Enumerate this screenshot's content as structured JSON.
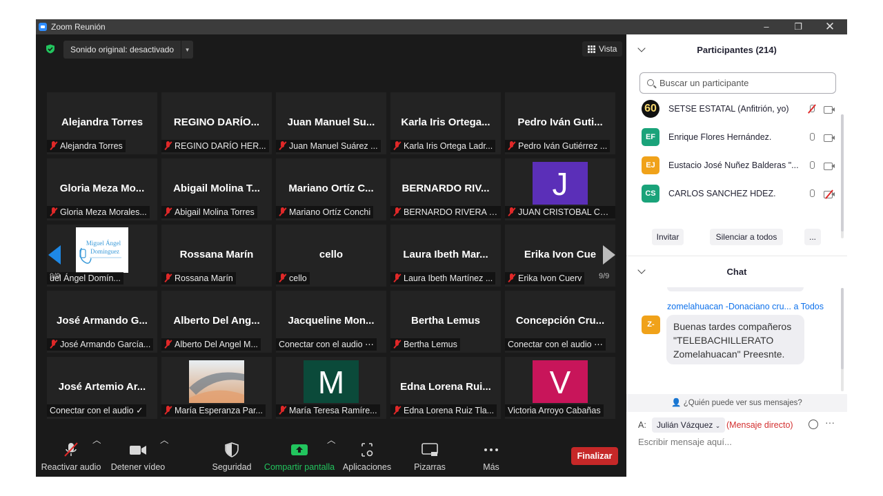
{
  "window": {
    "title": "Zoom Reunión",
    "minimize": "–",
    "maximize": "❐",
    "close": "✕"
  },
  "video": {
    "audio_button": "Sonido original: desactivado",
    "view_button": "Vista",
    "page_left": "9/9",
    "page_right": "9/9",
    "tiles": [
      {
        "display": "Alejandra Torres",
        "label": "Alejandra Torres",
        "muted": true
      },
      {
        "display": "REGINO DARÍO...",
        "label": "REGINO DARÍO HER...",
        "muted": true
      },
      {
        "display": "Juan Manuel Su...",
        "label": "Juan Manuel Suárez ...",
        "muted": true
      },
      {
        "display": "Karla Iris Ortega...",
        "label": "Karla Iris Ortega Ladr...",
        "muted": true
      },
      {
        "display": "Pedro Iván Guti...",
        "label": "Pedro Iván Gutiérrez ...",
        "muted": true
      },
      {
        "display": "Gloria Meza Mo...",
        "label": "Gloria Meza Morales...",
        "muted": true
      },
      {
        "display": "Abigail Molina T...",
        "label": "Abigail Molina Torres",
        "muted": true
      },
      {
        "display": "Mariano Ortíz C...",
        "label": "Mariano Ortíz Conchi",
        "muted": true
      },
      {
        "display": "BERNARDO RIV...",
        "label": "BERNARDO RIVERA C...",
        "muted": true
      },
      {
        "display": "",
        "label": "JUAN CRISTOBAL CO...",
        "muted": true,
        "letter": "J",
        "letter_color": "#5b2fb8"
      },
      {
        "display": "",
        "label": "uel Ángel Domín...",
        "muted": false,
        "logo": "Miguel Ángel\nDomínguez"
      },
      {
        "display": "Rossana Marín",
        "label": "Rossana Marín",
        "muted": true
      },
      {
        "display": "cello",
        "label": "cello",
        "muted": true
      },
      {
        "display": "Laura Ibeth Mar...",
        "label": "Laura Ibeth Martínez ...",
        "muted": true
      },
      {
        "display": "Erika Ivon Cue",
        "label": "Erika Ivon Cuerv",
        "muted": true
      },
      {
        "display": "José Armando G...",
        "label": "José Armando García...",
        "muted": true
      },
      {
        "display": "Alberto Del Ang...",
        "label": "Alberto Del Angel M...",
        "muted": true
      },
      {
        "display": "Jacqueline Mon...",
        "label": "Conectar con el audio ⋯",
        "muted": false
      },
      {
        "display": "Bertha Lemus",
        "label": "Bertha Lemus",
        "muted": true
      },
      {
        "display": "Concepción Cru...",
        "label": "Conectar con el audio ⋯",
        "muted": false
      },
      {
        "display": "José Artemio Ar...",
        "label": "Conectar con el audio ✓",
        "muted": false
      },
      {
        "display": "",
        "label": "María Esperanza Par...",
        "muted": true,
        "photo": true
      },
      {
        "display": "",
        "label": "María Teresa Ramíre...",
        "muted": true,
        "letter": "M",
        "letter_color": "#0b4a3a"
      },
      {
        "display": "Edna Lorena Rui...",
        "label": "Edna Lorena Ruiz Tla...",
        "muted": true
      },
      {
        "display": "",
        "label": "Victoria Arroyo Cabañas",
        "muted": false,
        "letter": "V",
        "letter_color": "#c8155a"
      }
    ]
  },
  "toolbar": {
    "unmute": "Reactivar audio",
    "stop_video": "Detener vídeo",
    "security": "Seguridad",
    "share": "Compartir pantalla",
    "apps": "Aplicaciones",
    "whiteboards": "Pizarras",
    "more": "Más",
    "end": "Finalizar"
  },
  "participants": {
    "header": "Participantes (214)",
    "search_placeholder": "Buscar un participante",
    "list": [
      {
        "initials": "60",
        "name": "SETSE ESTATAL (Anfitrión, yo)",
        "color": "#111111"
      },
      {
        "initials": "EF",
        "name": "Enrique Flores Hernández.",
        "color": "#1aa37a"
      },
      {
        "initials": "EJ",
        "name": "Eustacio José Nuñez Balderas \"...",
        "color": "#f0a21a"
      },
      {
        "initials": "CS",
        "name": "CARLOS SANCHEZ HDEZ.",
        "color": "#1aa37a"
      }
    ],
    "invite": "Invitar",
    "mute_all": "Silenciar a todos",
    "more": "..."
  },
  "chat": {
    "header": "Chat",
    "sender": "zomelahuacan -Donaciano cru...",
    "to": "a Todos",
    "avatar": "Z-",
    "message": "Buenas tardes compañeros \"TELEBACHILLERATO Zomelahuacan\" Preesnte.",
    "who_can_see": "¿Quién puede ver sus mensajes?",
    "to_label": "A:",
    "recipient": "Julián Vázquez",
    "direct": "(Mensaje directo)",
    "placeholder": "Escribir mensaje aquí...",
    "more": "···"
  }
}
